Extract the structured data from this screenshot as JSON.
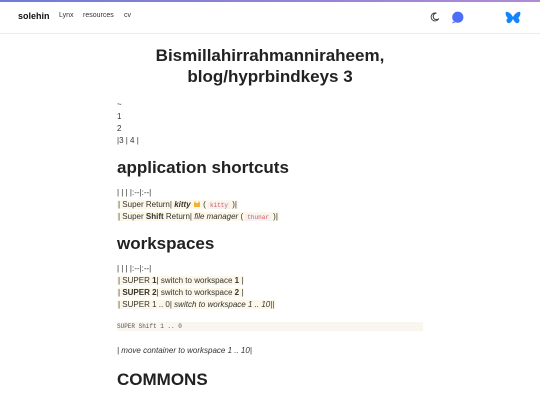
{
  "nav": {
    "brand": "solehin",
    "links": [
      "Lynx",
      "resources",
      "cv"
    ]
  },
  "icons": {
    "theme": "moon-icon",
    "chat": "chat-bubble-icon",
    "social": "butterfly-icon",
    "kitty_emoji": "cat-emoji",
    "accent": "#4f6ef7"
  },
  "page": {
    "title_line1": "Bismillahirrahmanniraheem,",
    "title_line2": "blog/hyprbindkeys 3"
  },
  "intro": [
    "~",
    "1",
    "2",
    "|3 | 4 |"
  ],
  "sections": {
    "apps": {
      "heading": "application shortcuts",
      "table_sep": "| | | |:--|:--|",
      "row1_prefix": "| Super Return|",
      "row1_bold": "kitty",
      "row1_code": "kitty",
      "row1_suffix": " )|",
      "row2_prefix": "| Super ",
      "row2_bold": "Shift",
      "row2_mid": " Return|",
      "row2_em": " file manager",
      "row2_code": "thunar",
      "row2_suffix": " )|"
    },
    "workspaces": {
      "heading": "workspaces",
      "table_sep": "| | | |:--|:--|",
      "row1_a": "| SUPER ",
      "row1_b": "1",
      "row1_c": "| switch to workspace ",
      "row1_d": "1",
      "row1_e": " |",
      "row2_a": "| ",
      "row2_b": "SUPER 2",
      "row2_c": "| switch to workspace ",
      "row2_d": "2",
      "row2_e": " |",
      "row3_a": "| SUPER 1 .. 0|",
      "row3_em": " switch to workspace 1 .. 10",
      "row3_e": "||",
      "code": "SUPER  Shift  1 .. 0",
      "move_em": "| move container to workspace 1 .. 10|"
    },
    "commons": {
      "heading": "COMMONS"
    }
  }
}
